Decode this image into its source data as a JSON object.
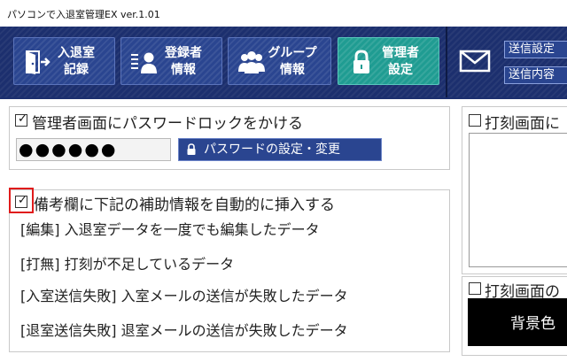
{
  "window": {
    "title": "パソコンで入退室管理EX ver.1.01"
  },
  "toolbar": {
    "buttons": [
      {
        "line1": "入退室",
        "line2": "記録",
        "icon": "door-exit-icon"
      },
      {
        "line1": "登録者",
        "line2": "情報",
        "icon": "user-list-icon"
      },
      {
        "line1": "グループ",
        "line2": "情報",
        "icon": "group-icon"
      },
      {
        "line1": "管理者",
        "line2": "設定",
        "icon": "lock-icon",
        "active": true
      }
    ],
    "mail_icon": "mail-icon",
    "send_settings_label": "送信設定",
    "send_content_label": "送信内容"
  },
  "password_section": {
    "checkbox_checked": true,
    "checkbox_label": "管理者画面にパスワードロックをかける",
    "password_value": "●●●●●●",
    "set_button_label": "パスワードの設定・変更"
  },
  "remarks_section": {
    "checkbox_checked": true,
    "checkbox_label": "備考欄に下記の補助情報を自動的に挿入する",
    "items": [
      "[編集]  入退室データを一度でも編集したデータ",
      "[打無]  打刻が不足しているデータ",
      "[入室送信失敗]  入室メールの送信が失敗したデータ",
      "[退室送信失敗]  退室メールの送信が失敗したデータ"
    ]
  },
  "right_panel": {
    "stamp_screen_label_1": "打刻画面に",
    "stamp_screen_label_2": "打刻画面の",
    "background_color_label": "背景色"
  },
  "colors": {
    "toolbar_bg": "#1c2f6e",
    "button_bg": "#2a4590",
    "active_button_bg": "#1f9c92",
    "highlight_red": "#e01b1b"
  }
}
